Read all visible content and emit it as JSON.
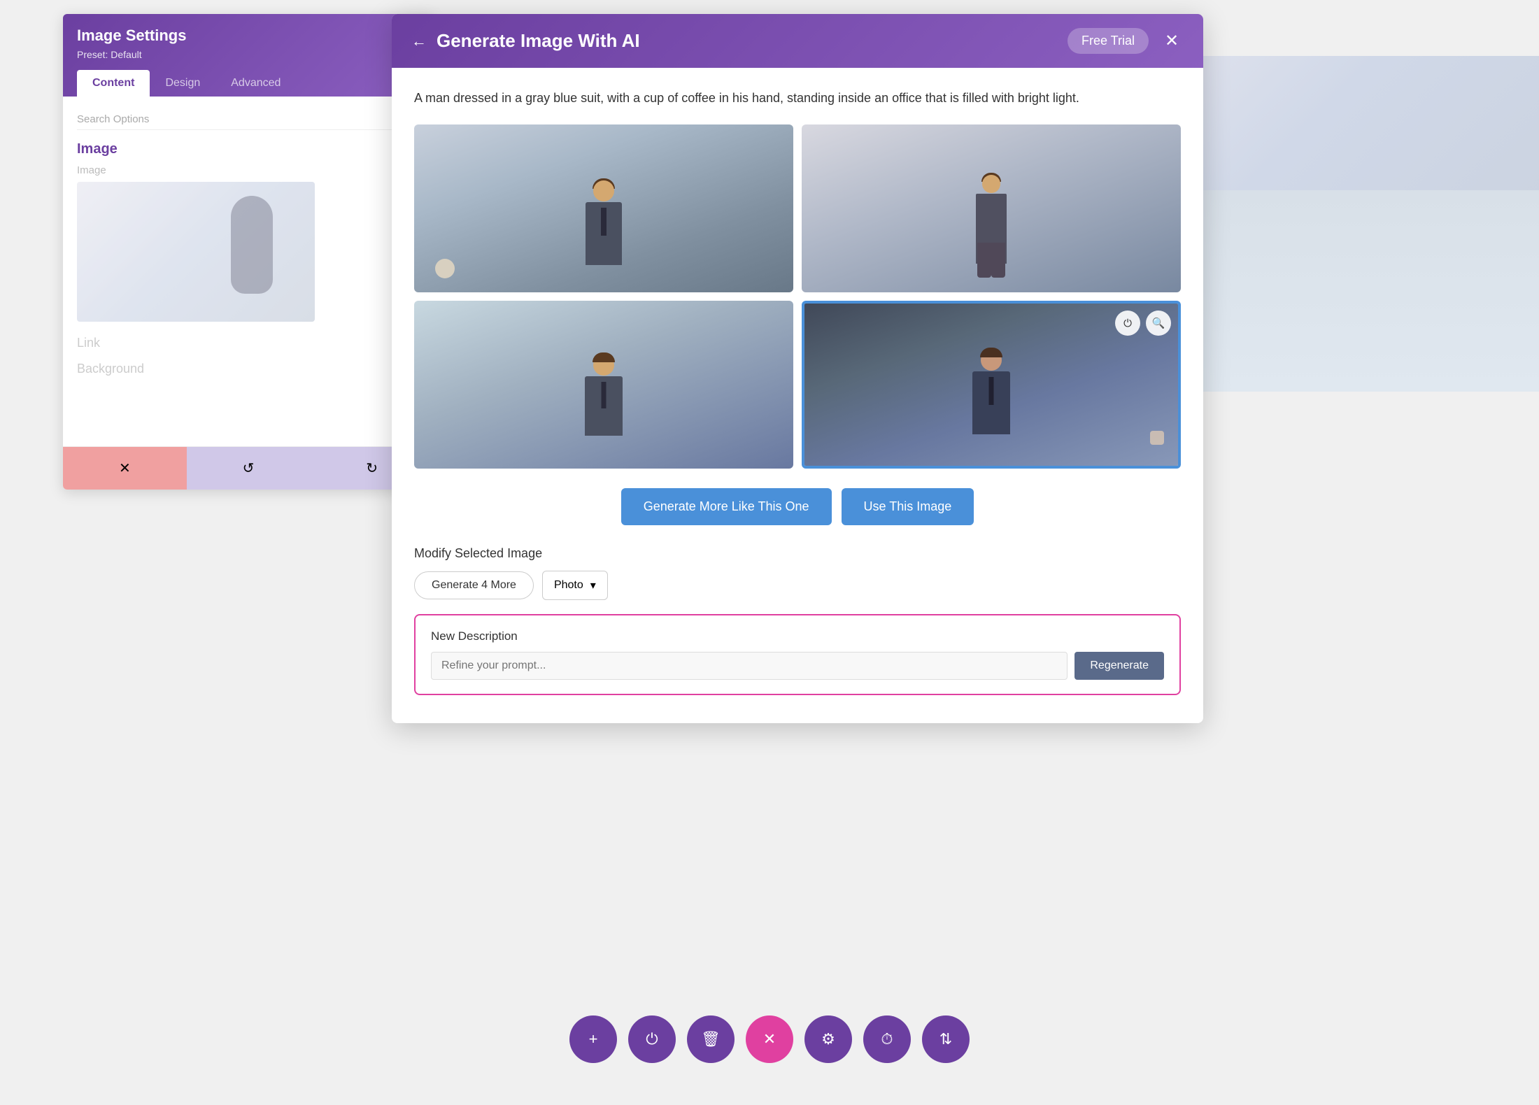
{
  "background": {
    "color": "#e8e8e8"
  },
  "image_settings_panel": {
    "title": "Image Settings",
    "preset_label": "Preset: Default",
    "settings_icon": "⚙",
    "tabs": [
      {
        "label": "Content",
        "active": true
      },
      {
        "label": "Design",
        "active": false
      },
      {
        "label": "Advanced",
        "active": false
      }
    ],
    "search_placeholder": "Search Options",
    "sections": [
      {
        "label": "Image"
      },
      {
        "label": "Link"
      },
      {
        "label": "Background"
      }
    ],
    "field_image_label": "Image",
    "actions": [
      {
        "label": "✕",
        "type": "delete"
      },
      {
        "label": "↺",
        "type": "undo"
      },
      {
        "label": "↻",
        "type": "redo"
      }
    ]
  },
  "ai_modal": {
    "title": "Generate Image With AI",
    "back_arrow": "←",
    "free_trial_label": "Free Trial",
    "close_icon": "✕",
    "prompt_text": "A man dressed in a gray blue suit, with a cup of coffee in his hand, standing inside an office that is filled with bright light.",
    "images": [
      {
        "id": 1,
        "alt": "Man with coffee close-up",
        "selected": false
      },
      {
        "id": 2,
        "alt": "Man walking in corridor",
        "selected": false
      },
      {
        "id": 3,
        "alt": "Man in office standing",
        "selected": false
      },
      {
        "id": 4,
        "alt": "Man with coffee city view",
        "selected": true
      }
    ],
    "overlay_icons": [
      {
        "name": "power-icon",
        "symbol": "⏻"
      },
      {
        "name": "zoom-icon",
        "symbol": "🔍"
      }
    ],
    "btn_generate_label": "Generate More Like This One",
    "btn_use_label": "Use This Image",
    "modify_title": "Modify Selected Image",
    "btn_generate_more_label": "Generate 4 More",
    "style_select_label": "Photo",
    "style_select_arrow": "▾",
    "new_description": {
      "title": "New Description",
      "input_placeholder": "Refine your prompt...",
      "btn_regenerate_label": "Regenerate"
    }
  },
  "bottom_toolbar": {
    "buttons": [
      {
        "symbol": "+",
        "label": "add",
        "active": false
      },
      {
        "symbol": "⏻",
        "label": "power",
        "active": false
      },
      {
        "symbol": "🗑",
        "label": "delete",
        "active": false
      },
      {
        "symbol": "✕",
        "label": "close",
        "active": true
      },
      {
        "symbol": "⚙",
        "label": "settings",
        "active": false
      },
      {
        "symbol": "⏱",
        "label": "history",
        "active": false
      },
      {
        "symbol": "⇅",
        "label": "layers",
        "active": false
      }
    ]
  }
}
